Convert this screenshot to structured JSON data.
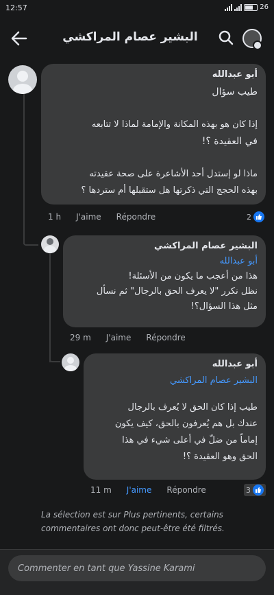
{
  "status": {
    "time": "12:57",
    "battery": "26"
  },
  "header": {
    "title": "البشير عصام المراكشي"
  },
  "comments": [
    {
      "author": "أبو عبدالله",
      "lines": [
        "طيب سؤال",
        "",
        "إذا كان هو بهذه المكانة والإمامة لماذا لا تتابعه",
        "في العقيدة ؟!",
        "",
        "ماذا لو إستدل أحد الأشاعرة على صحة عقيدته",
        "بهذه الحجج التي ذكرتها هل ستقبلها أم ستردها ؟"
      ],
      "time": "1 h",
      "like": "J'aime",
      "reply": "Répondre",
      "reactions": "2"
    },
    {
      "author": "البشير عصام المراكشي",
      "tag": "أبو عبدالله",
      "lines": [
        "هذا من أعجب ما يكون من الأسئلة!",
        "نظل نكرر \"لا يعرف الحق بالرجال\" ثم نسأل",
        "مثل هذا السؤال؟!"
      ],
      "time": "29 m",
      "like": "J'aime",
      "reply": "Répondre"
    },
    {
      "author": "أبو عبدالله",
      "tag": "البشير عصام المراكشي",
      "lines": [
        "طيب إذا كان الحق لا يُعرف بالرجال",
        "عندك بل هم يُعرفون بالحق، كيف يكون",
        "إماماً من ضلّ في أعلى شيء في هذا",
        "الحق وهو العقيدة ؟!"
      ],
      "time": "11 m",
      "like": "J'aime",
      "reply": "Répondre",
      "reactions": "3"
    }
  ],
  "notice": "La sélection est sur Plus pertinents, certains commentaires ont donc peut-être été filtrés.",
  "composer": {
    "placeholder": "Commenter en tant que Yassine Karami"
  },
  "colors": {
    "background": "#18191a",
    "bubble": "#3a3b3c",
    "accent": "#4599ff"
  },
  "icons": {
    "back": "arrow-left-icon",
    "search": "search-icon",
    "like": "thumbs-up-icon"
  }
}
